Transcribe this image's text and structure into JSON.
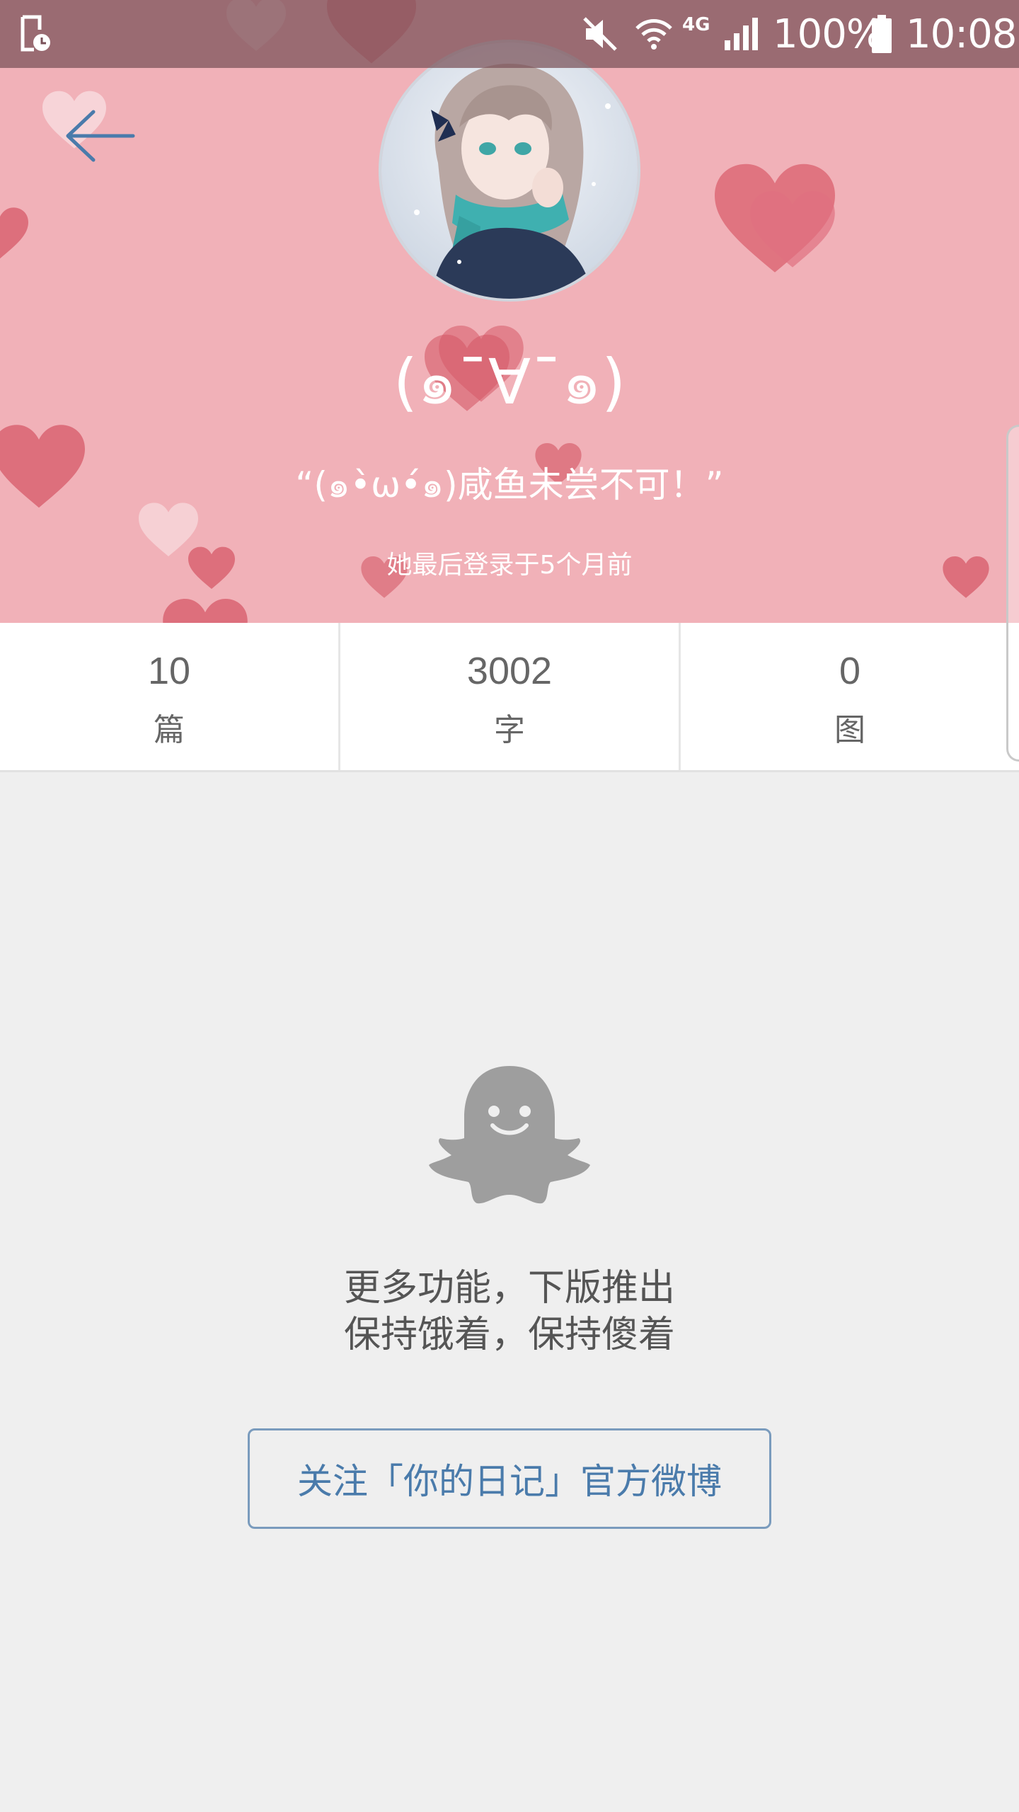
{
  "status_bar": {
    "network": "4G",
    "battery": "100%",
    "time": "10:08",
    "icons": [
      "clock-notification-icon",
      "mute-icon",
      "wifi-icon",
      "signal-icon",
      "battery-icon"
    ]
  },
  "header": {
    "back_icon": "arrow-left-icon",
    "background_color": "#f1b1b8",
    "accent_color": "#4a7bab"
  },
  "profile": {
    "name": "(๑¯∀¯๑)",
    "motto": "“(๑•̀ω•́๑)咸鱼未尝不可！”",
    "last_login": "她最后登录于5个月前"
  },
  "stats": [
    {
      "value": "10",
      "label": "篇"
    },
    {
      "value": "3002",
      "label": "字"
    },
    {
      "value": "0",
      "label": "图"
    }
  ],
  "empty_state": {
    "icon": "ghost-icon",
    "line1": "更多功能，下版推出",
    "line2": "保持饿着，保持傻着"
  },
  "follow_button": {
    "label": "关注「你的日记」官方微博"
  }
}
